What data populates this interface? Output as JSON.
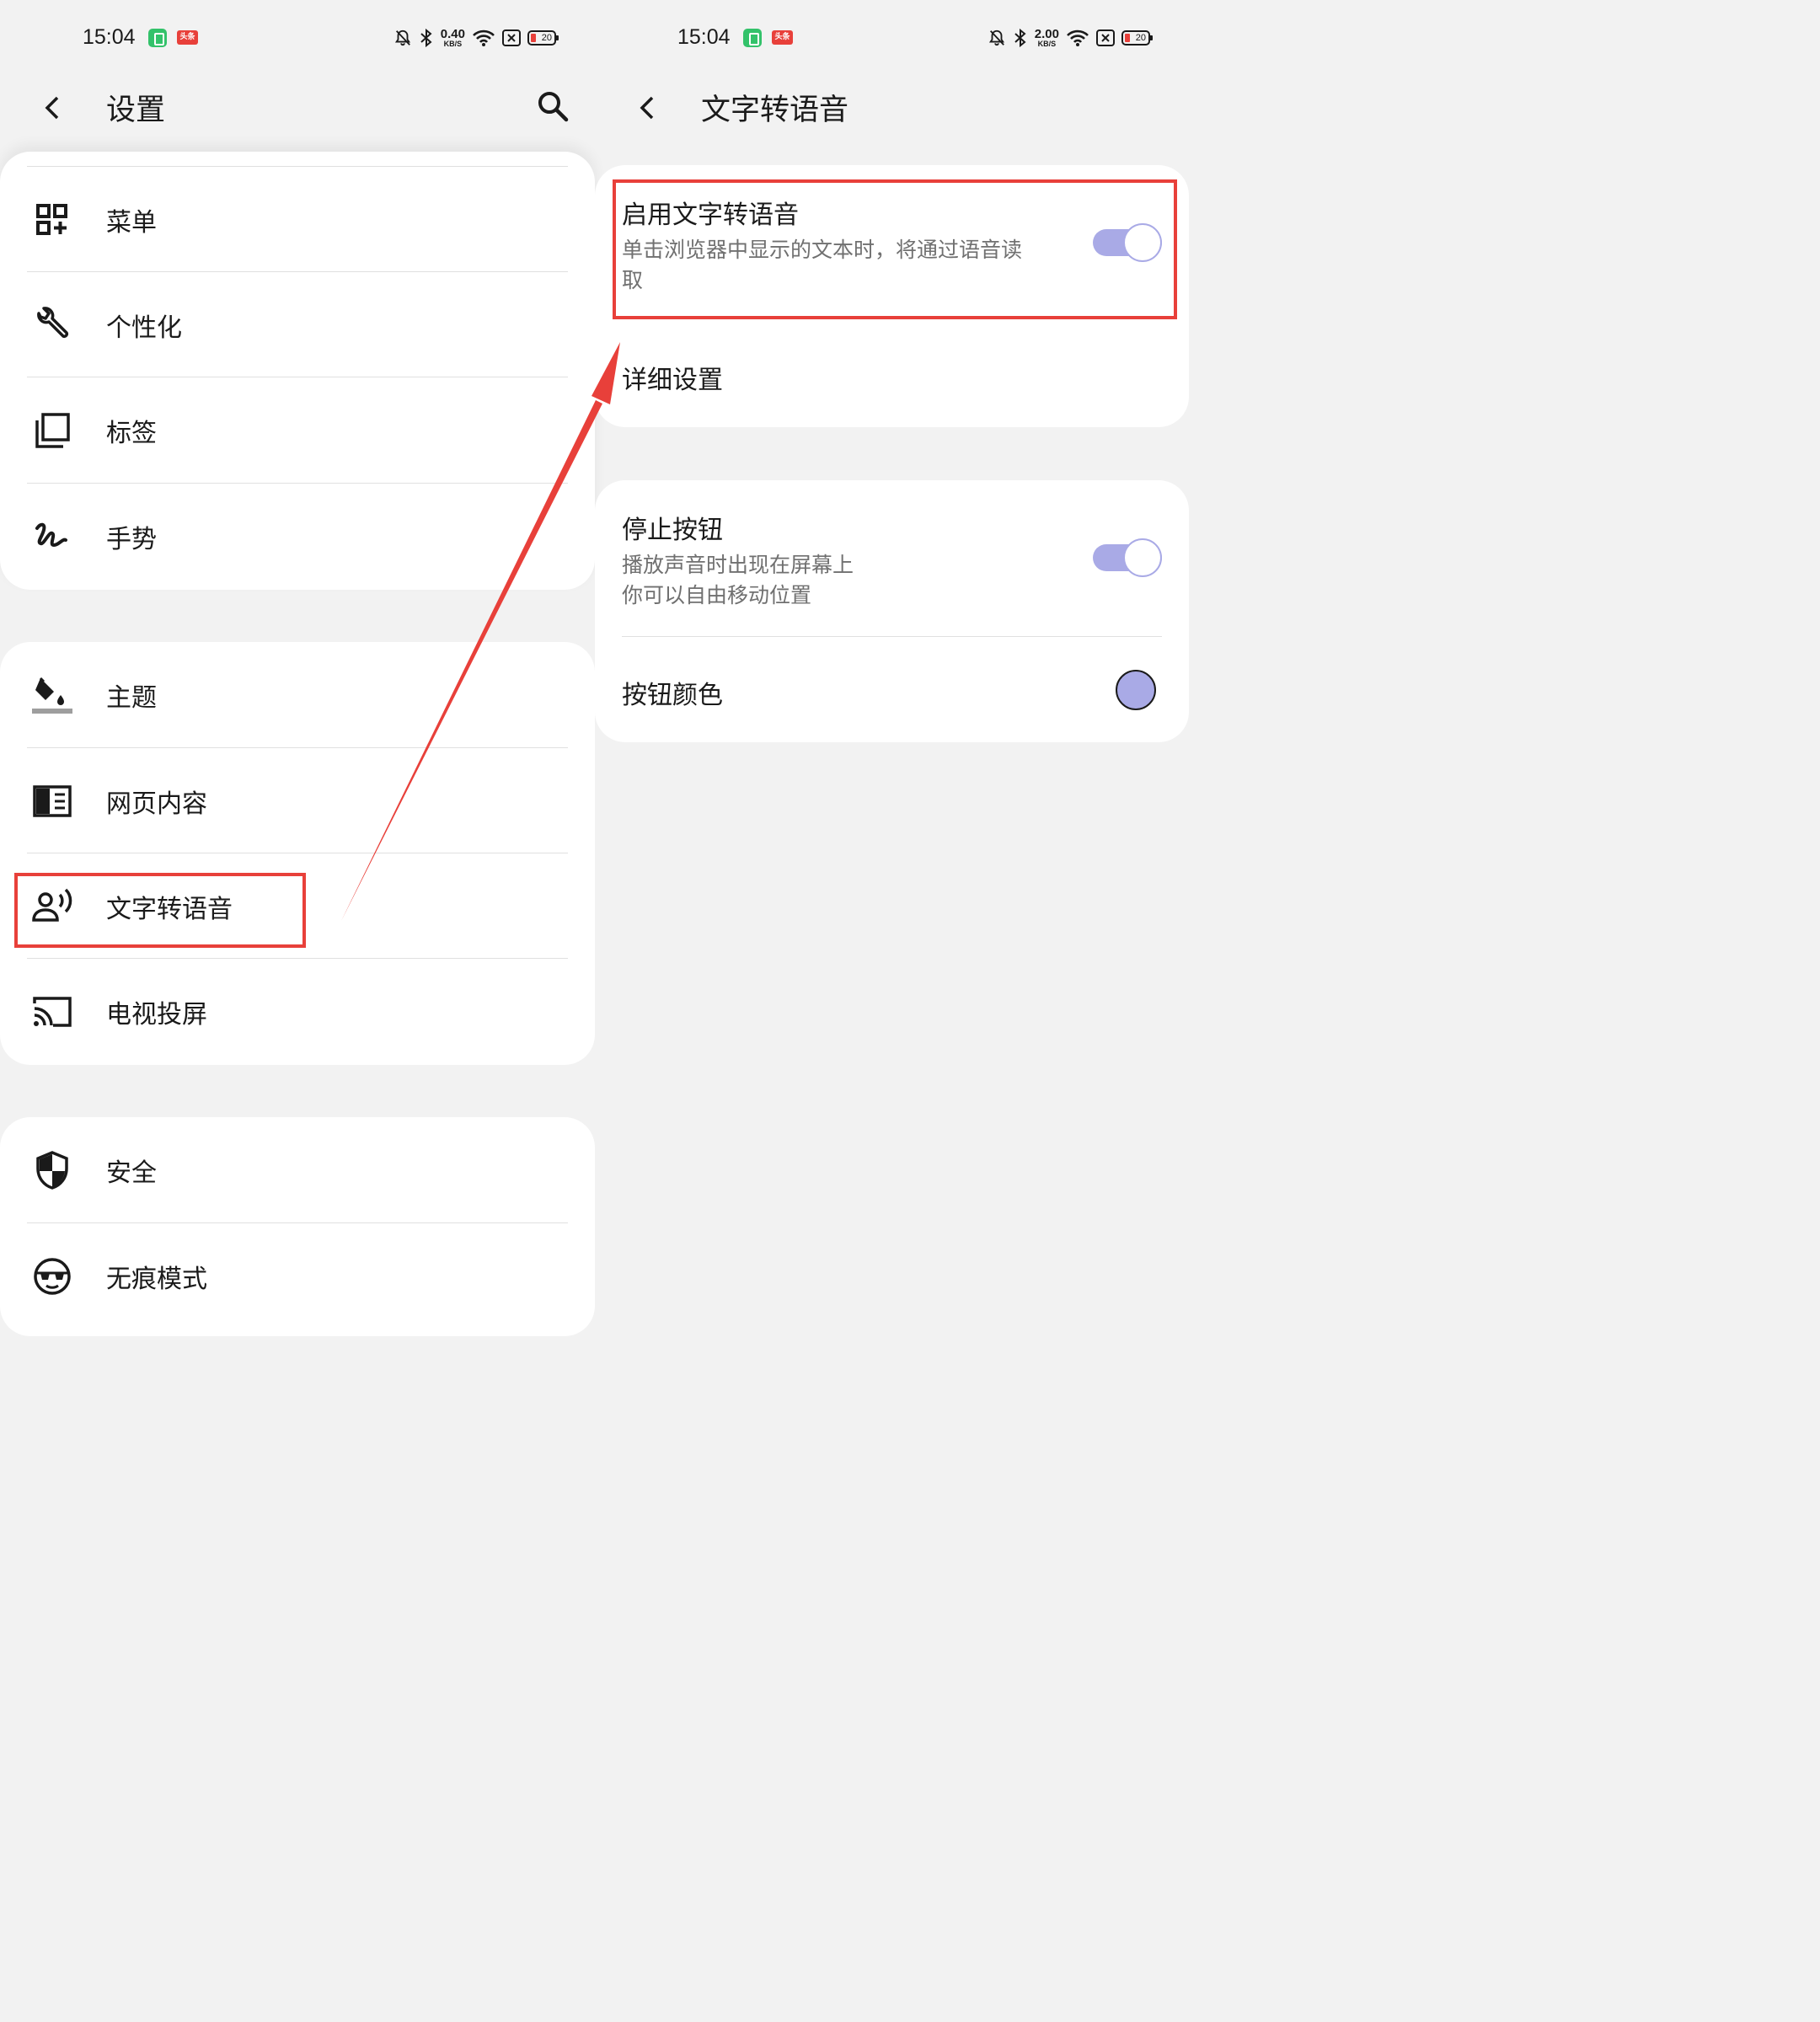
{
  "left": {
    "status": {
      "time": "15:04",
      "app2": "头条",
      "speed_value": "0.40",
      "speed_unit": "KB/S",
      "battery": "20"
    },
    "header": {
      "title": "设置"
    },
    "groups": [
      {
        "items": [
          {
            "icon": "grid-add-icon",
            "label": "菜单"
          },
          {
            "icon": "wrench-icon",
            "label": "个性化"
          },
          {
            "icon": "tabs-icon",
            "label": "标签"
          },
          {
            "icon": "gesture-icon",
            "label": "手势"
          }
        ]
      },
      {
        "items": [
          {
            "icon": "paint-bucket-icon",
            "label": "主题"
          },
          {
            "icon": "web-content-icon",
            "label": "网页内容"
          },
          {
            "icon": "text-to-speech-icon",
            "label": "文字转语音"
          },
          {
            "icon": "cast-icon",
            "label": "电视投屏"
          }
        ]
      },
      {
        "items": [
          {
            "icon": "shield-icon",
            "label": "安全"
          },
          {
            "icon": "incognito-icon",
            "label": "无痕模式"
          }
        ]
      }
    ]
  },
  "right": {
    "status": {
      "time": "15:04",
      "app2": "头条",
      "speed_value": "2.00",
      "speed_unit": "KB/S",
      "battery": "20"
    },
    "header": {
      "title": "文字转语音"
    },
    "tts": {
      "enable_title": "启用文字转语音",
      "enable_desc_line1": "单击浏览器中显示的文本时，将通过语音读",
      "enable_desc_line2": "取",
      "enabled": true,
      "details_title": "详细设置"
    },
    "stop_button": {
      "title": "停止按钮",
      "desc_line1": "播放声音时出现在屏幕上",
      "desc_line2": "你可以自由移动位置",
      "enabled": true,
      "color_title": "按钮颜色",
      "color": "#a9aae6"
    }
  },
  "colors": {
    "accent": "#a9aae6",
    "highlight": "#e8403a",
    "background": "#f2f2f2"
  }
}
